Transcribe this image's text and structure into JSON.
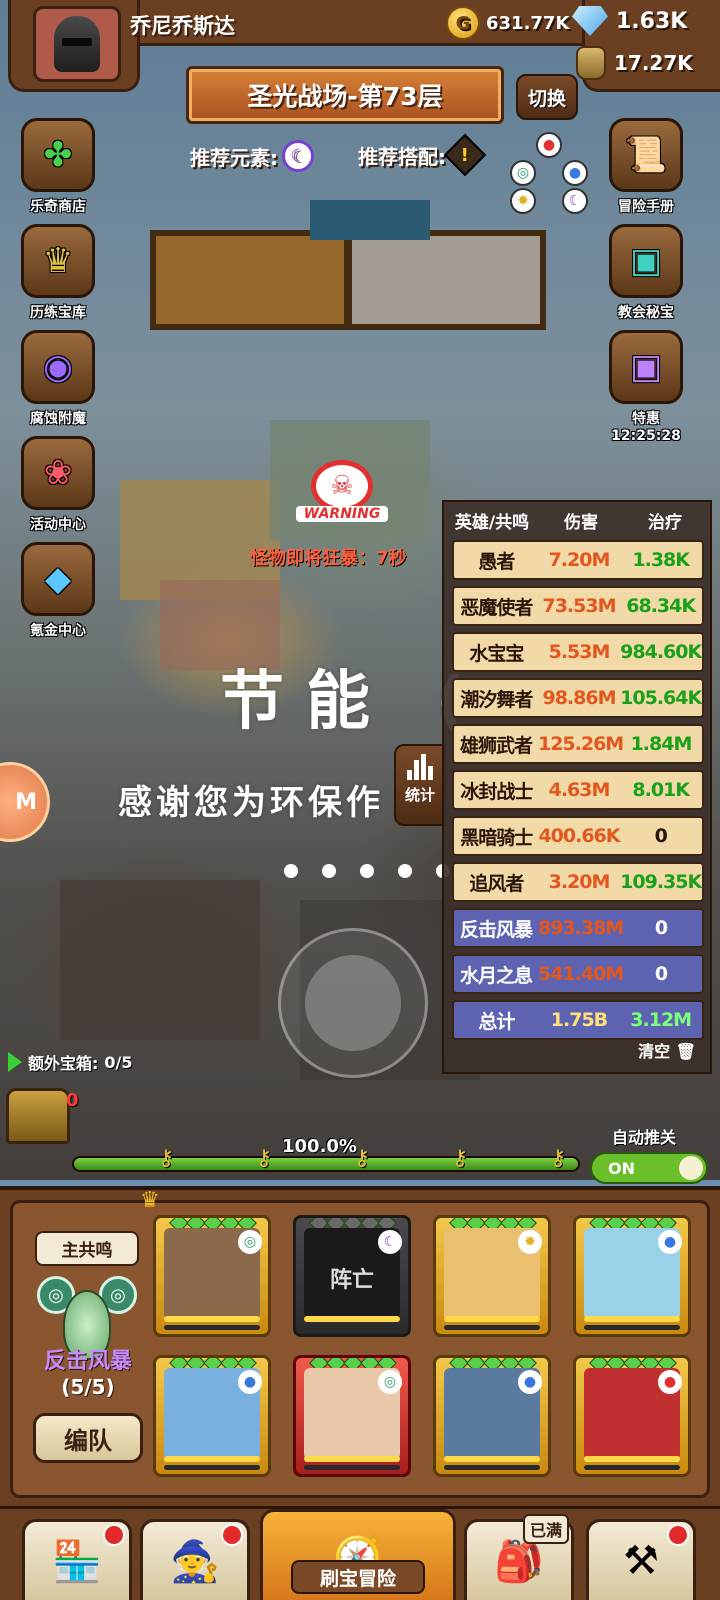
{
  "player": {
    "name": "乔尼乔斯达"
  },
  "resources": {
    "gold": "631.77K",
    "gems": "1.63K",
    "jar": "17.27K"
  },
  "stage": {
    "title": "圣光战场-第73层",
    "switch_label": "切换"
  },
  "recommend": {
    "element_label": "推荐元素:",
    "combo_label": "推荐搭配:"
  },
  "left_menu": [
    {
      "label": "乐奇商店",
      "icon": "clover-icon"
    },
    {
      "label": "历练宝库",
      "icon": "treasure-icon"
    },
    {
      "label": "腐蚀附魔",
      "icon": "vortex-icon"
    },
    {
      "label": "活动中心",
      "icon": "bouquet-icon"
    },
    {
      "label": "氪金中心",
      "icon": "diamond-icon"
    }
  ],
  "right_menu": [
    {
      "label": "冒险手册",
      "icon": "scroll-icon"
    },
    {
      "label": "教会秘宝",
      "icon": "chest-icon"
    },
    {
      "label": "特惠",
      "icon": "gift-chest-icon",
      "timer": "12:25:28"
    }
  ],
  "warning": {
    "text": "WARNING",
    "rage": "怪物即将狂暴：7秒"
  },
  "energy_saving": {
    "title": "节能 (",
    "subtitle": "感谢您为环保作"
  },
  "stats_button": "统计",
  "stats": {
    "headers": [
      "英雄/共鸣",
      "伤害",
      "治疗"
    ],
    "rows": [
      {
        "name": "愚者",
        "damage": "7.20M",
        "heal": "1.38K",
        "style": "tan"
      },
      {
        "name": "恶魔使者",
        "damage": "73.53M",
        "heal": "68.34K",
        "style": "tan"
      },
      {
        "name": "水宝宝",
        "damage": "5.53M",
        "heal": "984.60K",
        "style": "tan"
      },
      {
        "name": "潮汐舞者",
        "damage": "98.86M",
        "heal": "105.64K",
        "style": "tan"
      },
      {
        "name": "雄狮武者",
        "damage": "125.26M",
        "heal": "1.84M",
        "style": "tan"
      },
      {
        "name": "冰封战士",
        "damage": "4.63M",
        "heal": "8.01K",
        "style": "tan"
      },
      {
        "name": "黑暗骑士",
        "damage": "400.66K",
        "heal": "0",
        "style": "tan"
      },
      {
        "name": "追风者",
        "damage": "3.20M",
        "heal": "109.35K",
        "style": "tan"
      },
      {
        "name": "反击风暴",
        "damage": "893.38M",
        "heal": "0",
        "style": "blue"
      },
      {
        "name": "水月之息",
        "damage": "541.40M",
        "heal": "0",
        "style": "blue"
      },
      {
        "name": "总计",
        "damage": "1.75B",
        "heal": "3.12M",
        "style": "blue total"
      }
    ],
    "clear_label": "清空"
  },
  "extra_chest": {
    "label": "额外宝箱:",
    "value": "0/5",
    "count": "0"
  },
  "progress": {
    "value": 1.0,
    "label": "100.0%"
  },
  "auto": {
    "label": "自动推关",
    "toggle": "ON"
  },
  "team": {
    "main_label": "主共鸣",
    "resonance_name": "反击风暴",
    "resonance_count": "(5/5)",
    "formation_label": "编队",
    "dead_label": "阵亡",
    "heroes": [
      {
        "element": "wind-icon",
        "state": "normal"
      },
      {
        "element": "moon-icon",
        "state": "dead"
      },
      {
        "element": "light-icon",
        "state": "normal"
      },
      {
        "element": "water-icon",
        "state": "normal"
      },
      {
        "element": "water-icon",
        "state": "normal"
      },
      {
        "element": "wind-icon",
        "state": "red"
      },
      {
        "element": "water-icon",
        "state": "normal"
      },
      {
        "element": "fire-icon",
        "state": "normal"
      }
    ]
  },
  "bottom_nav": {
    "adventure_label": "刷宝冒险",
    "full_label": "已满"
  }
}
